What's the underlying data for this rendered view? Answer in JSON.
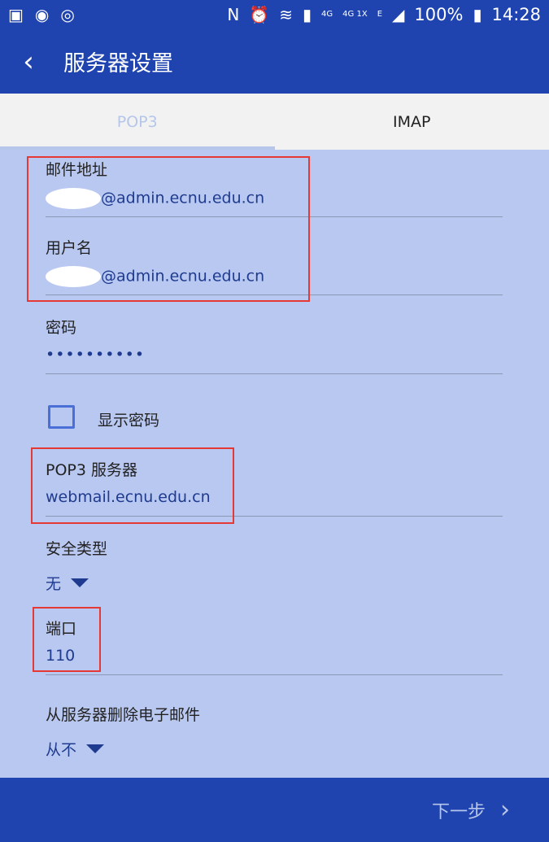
{
  "status_bar": {
    "signal_4g_label": "4G",
    "signal_4g1x_label": "4G 1X",
    "signal_e_label": "E",
    "battery": "100%",
    "time": "14:28"
  },
  "header": {
    "title": "服务器设置"
  },
  "tabs": [
    {
      "label": "POP3"
    },
    {
      "label": "IMAP"
    }
  ],
  "form": {
    "email_label": "邮件地址",
    "email_value": "@admin.ecnu.edu.cn",
    "username_label": "用户名",
    "username_value": "@admin.ecnu.edu.cn",
    "password_label": "密码",
    "password_value": "••••••••••",
    "show_password_label": "显示密码",
    "server_label": "POP3 服务器",
    "server_value": "webmail.ecnu.edu.cn",
    "security_label": "安全类型",
    "security_value": "无",
    "port_label": "端口",
    "port_value": "110",
    "delete_label": "从服务器删除电子邮件",
    "delete_value": "从不"
  },
  "footer": {
    "next_label": "下一步"
  }
}
